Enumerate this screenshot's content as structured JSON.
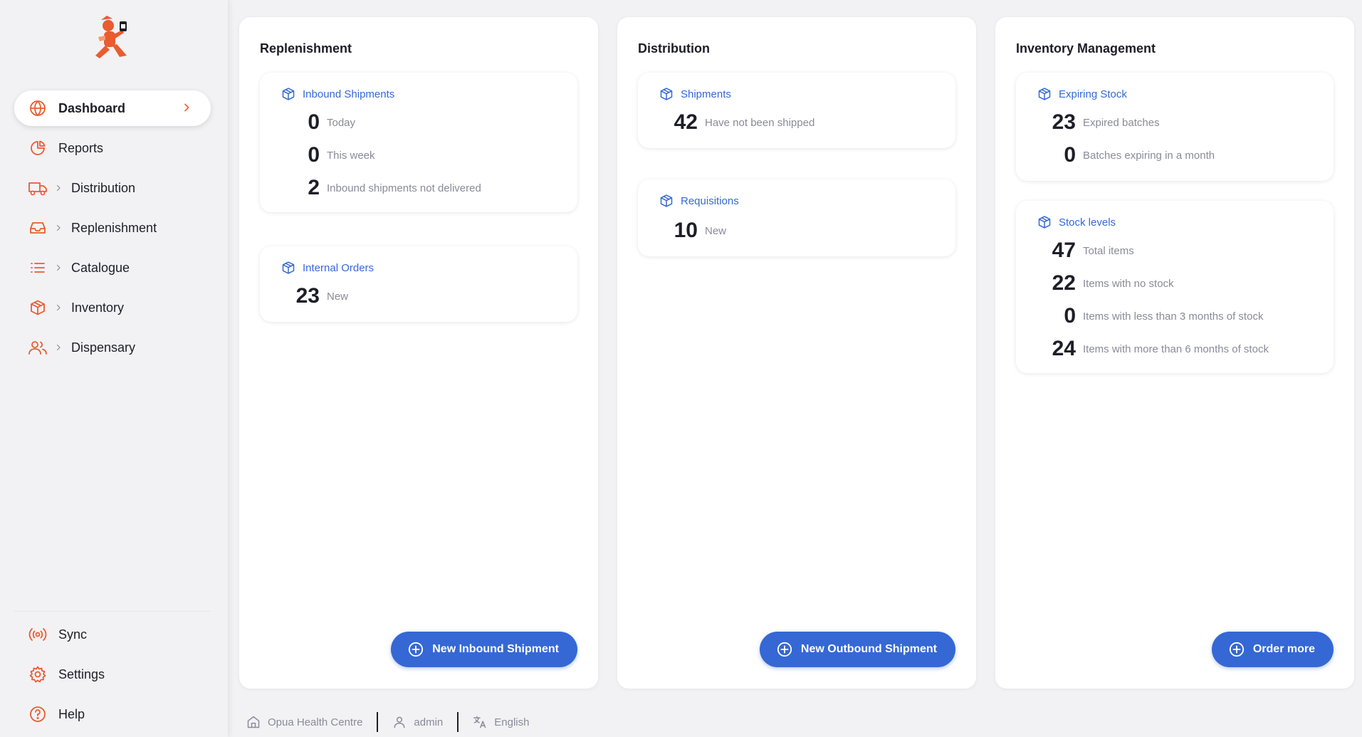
{
  "sidebar": {
    "logo": "logo-mascot",
    "items": [
      {
        "label": "Dashboard",
        "icon": "globe-icon"
      },
      {
        "label": "Reports",
        "icon": "pie-chart-icon"
      },
      {
        "label": "Distribution",
        "icon": "truck-icon"
      },
      {
        "label": "Replenishment",
        "icon": "inbox-icon"
      },
      {
        "label": "Catalogue",
        "icon": "list-icon"
      },
      {
        "label": "Inventory",
        "icon": "box-icon"
      },
      {
        "label": "Dispensary",
        "icon": "users-icon"
      }
    ],
    "bottom": [
      {
        "label": "Sync",
        "icon": "radio-icon"
      },
      {
        "label": "Settings",
        "icon": "gear-icon"
      },
      {
        "label": "Help",
        "icon": "help-circle-icon"
      }
    ]
  },
  "colors": {
    "accent": "#e95c30",
    "primary": "#3568d4"
  },
  "panels": {
    "replenishment": {
      "title": "Replenishment",
      "inbound": {
        "title": "Inbound Shipments",
        "stats": [
          {
            "value": "0",
            "label": "Today"
          },
          {
            "value": "0",
            "label": "This week"
          },
          {
            "value": "2",
            "label": "Inbound shipments not delivered"
          }
        ]
      },
      "internal": {
        "title": "Internal Orders",
        "stats": [
          {
            "value": "23",
            "label": "New"
          }
        ]
      },
      "button": "New Inbound Shipment"
    },
    "distribution": {
      "title": "Distribution",
      "shipments": {
        "title": "Shipments",
        "stats": [
          {
            "value": "42",
            "label": "Have not been shipped"
          }
        ]
      },
      "requisitions": {
        "title": "Requisitions",
        "stats": [
          {
            "value": "10",
            "label": "New"
          }
        ]
      },
      "button": "New Outbound Shipment"
    },
    "inventory": {
      "title": "Inventory Management",
      "expiring": {
        "title": "Expiring Stock",
        "stats": [
          {
            "value": "23",
            "label": "Expired batches"
          },
          {
            "value": "0",
            "label": "Batches expiring in a month"
          }
        ]
      },
      "stock": {
        "title": "Stock levels",
        "stats": [
          {
            "value": "47",
            "label": "Total items"
          },
          {
            "value": "22",
            "label": "Items with no stock"
          },
          {
            "value": "0",
            "label": "Items with less than 3 months of stock"
          },
          {
            "value": "24",
            "label": "Items with more than 6 months of stock"
          }
        ]
      },
      "button": "Order more"
    }
  },
  "footer": {
    "store": "Opua Health Centre",
    "user": "admin",
    "language": "English"
  }
}
